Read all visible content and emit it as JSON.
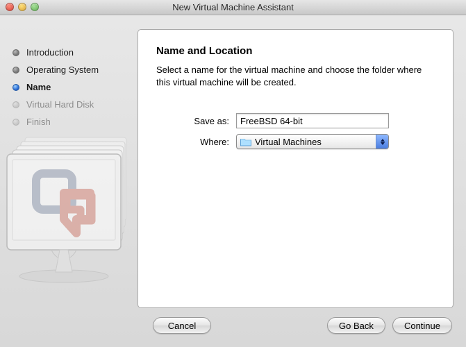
{
  "window": {
    "title": "New Virtual Machine Assistant"
  },
  "steps": [
    {
      "label": "Introduction",
      "state": "done"
    },
    {
      "label": "Operating System",
      "state": "done"
    },
    {
      "label": "Name",
      "state": "current"
    },
    {
      "label": "Virtual Hard Disk",
      "state": "pending"
    },
    {
      "label": "Finish",
      "state": "pending"
    }
  ],
  "pane": {
    "heading": "Name and Location",
    "description": "Select a name for the virtual machine and choose the folder where this virtual machine will be created.",
    "save_as_label": "Save as:",
    "save_as_value": "FreeBSD 64-bit",
    "where_label": "Where:",
    "where_value": "Virtual Machines"
  },
  "buttons": {
    "cancel": "Cancel",
    "go_back": "Go Back",
    "continue": "Continue"
  }
}
